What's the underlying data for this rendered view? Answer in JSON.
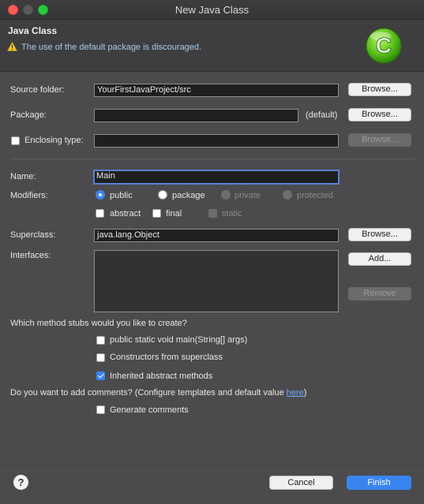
{
  "window": {
    "title": "New Java Class"
  },
  "header": {
    "title": "Java Class",
    "message": "The use of the default package is discouraged.",
    "logo_letter": "C"
  },
  "form": {
    "source_folder": {
      "label": "Source folder:",
      "value": "YourFirstJavaProject/src",
      "browse": "Browse..."
    },
    "package": {
      "label": "Package:",
      "value": "",
      "hint": "(default)",
      "browse": "Browse..."
    },
    "enclosing_type": {
      "label": "Enclosing type:",
      "value": "",
      "browse": "Browse...",
      "checked": false
    },
    "name": {
      "label": "Name:",
      "value": "Main"
    },
    "modifiers": {
      "label": "Modifiers:",
      "public": "public",
      "package": "package",
      "private": "private",
      "protected": "protected",
      "abstract": "abstract",
      "final": "final",
      "static": "static",
      "selected": "public"
    },
    "superclass": {
      "label": "Superclass:",
      "value": "java.lang.Object",
      "browse": "Browse..."
    },
    "interfaces": {
      "label": "Interfaces:",
      "add": "Add...",
      "remove": "Remove",
      "items": []
    },
    "stubs": {
      "question": "Which method stubs would you like to create?",
      "main": {
        "label": "public static void main(String[] args)",
        "checked": false
      },
      "constructors": {
        "label": "Constructors from superclass",
        "checked": false
      },
      "inherited": {
        "label": "Inherited abstract methods",
        "checked": true
      }
    },
    "comments": {
      "question_prefix": "Do you want to add comments? (Configure templates and default value ",
      "link": "here",
      "question_suffix": ")",
      "generate": {
        "label": "Generate comments",
        "checked": false
      }
    }
  },
  "footer": {
    "help": "?",
    "cancel": "Cancel",
    "finish": "Finish"
  },
  "colors": {
    "accent": "#3a84f0",
    "window_bg": "#4b4b4d",
    "header_bg": "#3e3e40",
    "info_text": "#a9c9e8"
  }
}
